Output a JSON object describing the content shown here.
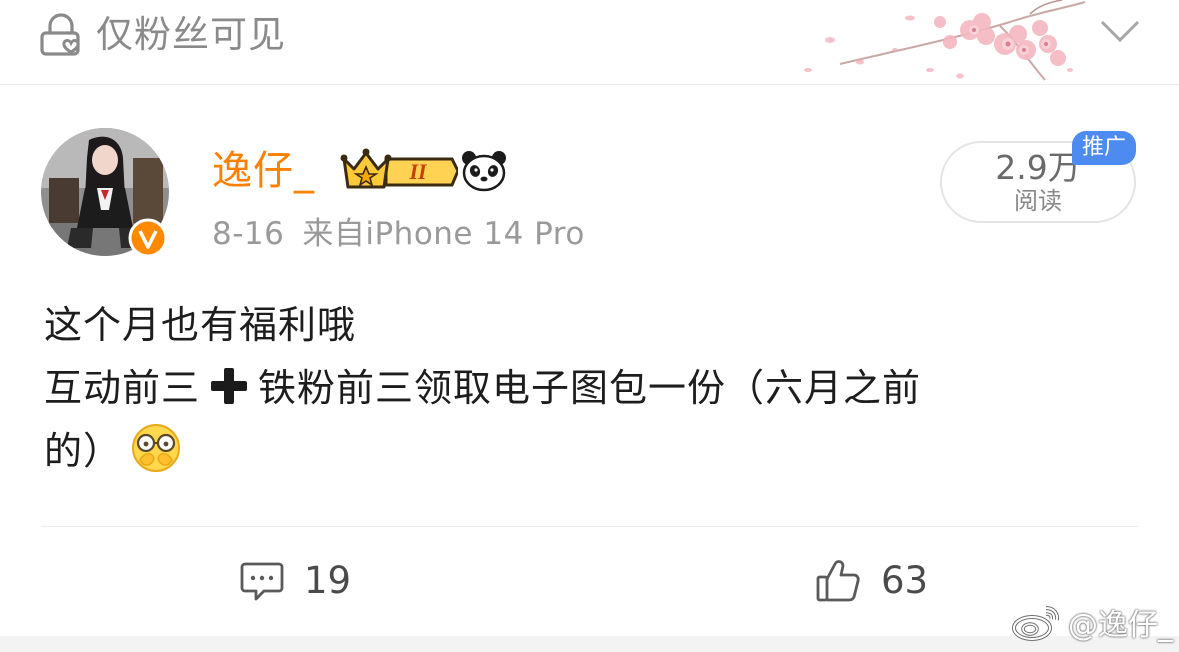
{
  "visibility": {
    "label": "仅粉丝可见",
    "icon": "lock-heart-icon"
  },
  "author": {
    "name": "逸仔_",
    "vip_level": "II",
    "verified": true,
    "badge_icon": "crown-vip-icon",
    "extra_icon": "panda-icon"
  },
  "meta": {
    "date": "8-16",
    "source": "来自iPhone 14 Pro"
  },
  "stats": {
    "reads": "2.9万",
    "reads_label": "阅读",
    "promo_tag": "推广"
  },
  "post": {
    "line1": "这个月也有福利哦",
    "line2_a": "互动前三",
    "line2_b": "铁粉前三领取电子图包一份（六月之前",
    "line3": "的）",
    "inline_icons": [
      "plus-icon",
      "hands-over-face-emoji-icon"
    ]
  },
  "actions": {
    "comments": "19",
    "likes": "63"
  },
  "watermark": {
    "text": "@逸仔_"
  },
  "colors": {
    "username": "#ff7f00",
    "promo": "#4e8bf0",
    "verified": "#ff8a00",
    "meta": "#9a9a9a"
  }
}
